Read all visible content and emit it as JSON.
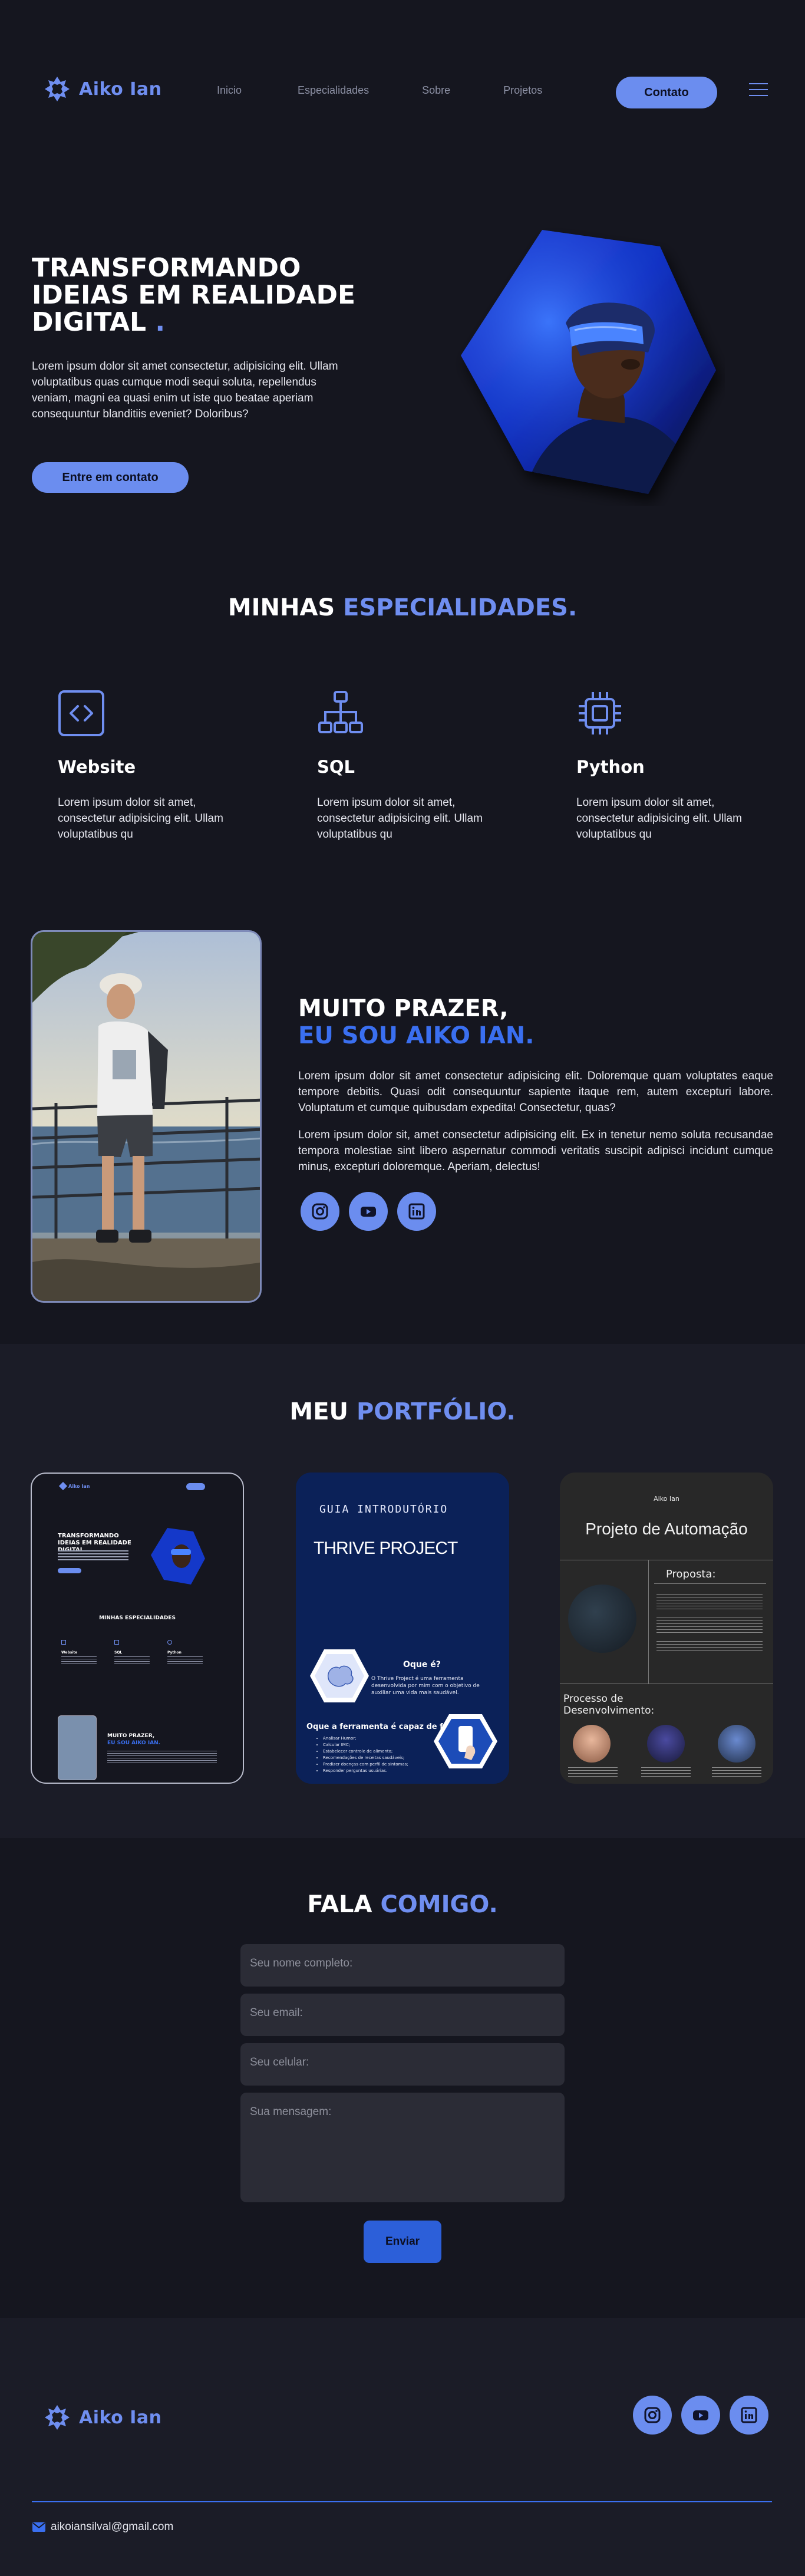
{
  "brand": {
    "name": "Aiko Ian",
    "color": "#6f8ef0"
  },
  "nav": {
    "items": [
      "Inicio",
      "Especialidades",
      "Sobre",
      "Projetos"
    ],
    "contact_label": "Contato"
  },
  "hero": {
    "title_line1": "TRANSFORMANDO",
    "title_line2": "IDEIAS EM REALIDADE",
    "title_line3": "DIGITAL",
    "title_dot": ".",
    "text": "Lorem ipsum dolor sit amet consectetur, adipisicing elit. Ullam voluptatibus quas cumque modi sequi soluta, repellendus veniam, magni ea quasi enim ut iste quo beatae aperiam consequuntur blanditiis eveniet? Doloribus?",
    "button_label": "Entre em contato",
    "image_alt": "VR headset portrait"
  },
  "specialties": {
    "title_part1": "MINHAS",
    "title_part2": "ESPECIALIDADES.",
    "items": [
      {
        "icon": "code-icon",
        "title": "Website",
        "text": "Lorem ipsum dolor sit amet, consectetur adipisicing elit. Ullam voluptatibus qu"
      },
      {
        "icon": "sitemap-icon",
        "title": "SQL",
        "text": "Lorem ipsum dolor sit amet, consectetur adipisicing elit. Ullam voluptatibus qu"
      },
      {
        "icon": "chip-icon",
        "title": "Python",
        "text": "Lorem ipsum dolor sit amet, consectetur adipisicing elit. Ullam voluptatibus qu"
      }
    ]
  },
  "about": {
    "title_line1": "MUITO PRAZER,",
    "title_line2": "EU SOU AIKO IAN.",
    "paragraph1": "Lorem ipsum dolor sit amet consectetur adipisicing elit. Doloremque quam voluptates eaque tempore debitis. Quasi odit consequuntur sapiente itaque rem, autem excepturi labore. Voluptatum et cumque quibusdam expedita! Consectetur, quas?",
    "paragraph2": "Lorem ipsum dolor sit, amet consectetur adipisicing elit. Ex in tenetur nemo soluta recusandae tempora molestiae sint libero aspernatur commodi veritatis suscipit adipisci incidunt cumque minus, excepturi doloremque. Aperiam, delectus!"
  },
  "social": [
    "instagram-icon",
    "youtube-icon",
    "linkedin-icon"
  ],
  "portfolio": {
    "title_part1": "MEU",
    "title_part2": "PORTFÓLIO.",
    "card1": {
      "brand": "Aiko Ian",
      "hero_title": "TRANSFORMANDO IDEIAS EM REALIDADE DIGITAL",
      "spec_title": "MINHAS ESPECIALIDADES",
      "specs": [
        "Website",
        "SQL",
        "Python"
      ],
      "about_title": "MUITO PRAZER,",
      "about_sub": "EU SOU AIKO IAN."
    },
    "card2": {
      "kicker": "GUIA INTRODUTÓRIO",
      "title": "THRIVE PROJECT",
      "q1": "Oque é?",
      "a1": "O Thrive Project é uma ferramenta desenvolvida por mim com o objetivo de auxiliar uma vida mais saudável.",
      "q2": "Oque a ferramenta é capaz de fazer?",
      "bullets": [
        "Analisar Humor;",
        "Calcular IMC;",
        "Estabelecer controle de alimento;",
        "Recomendações de receitas saudáveis;",
        "Predizer doenças com perfil de sintomas;",
        "Responder perguntas usuárias."
      ]
    },
    "card3": {
      "brand": "Aiko Ian",
      "title": "Projeto de Automação",
      "proposal": "Proposta:",
      "process": "Processo de Desenvolvimento:"
    }
  },
  "contact": {
    "title_part1": "FALA",
    "title_part2": "COMIGO.",
    "name_placeholder": "Seu nome completo:",
    "email_placeholder": "Seu email:",
    "phone_placeholder": "Seu celular:",
    "message_placeholder": "Sua mensagem:",
    "send_label": "Enviar"
  },
  "footer": {
    "email": "aikoiansilval@gmail.com"
  }
}
